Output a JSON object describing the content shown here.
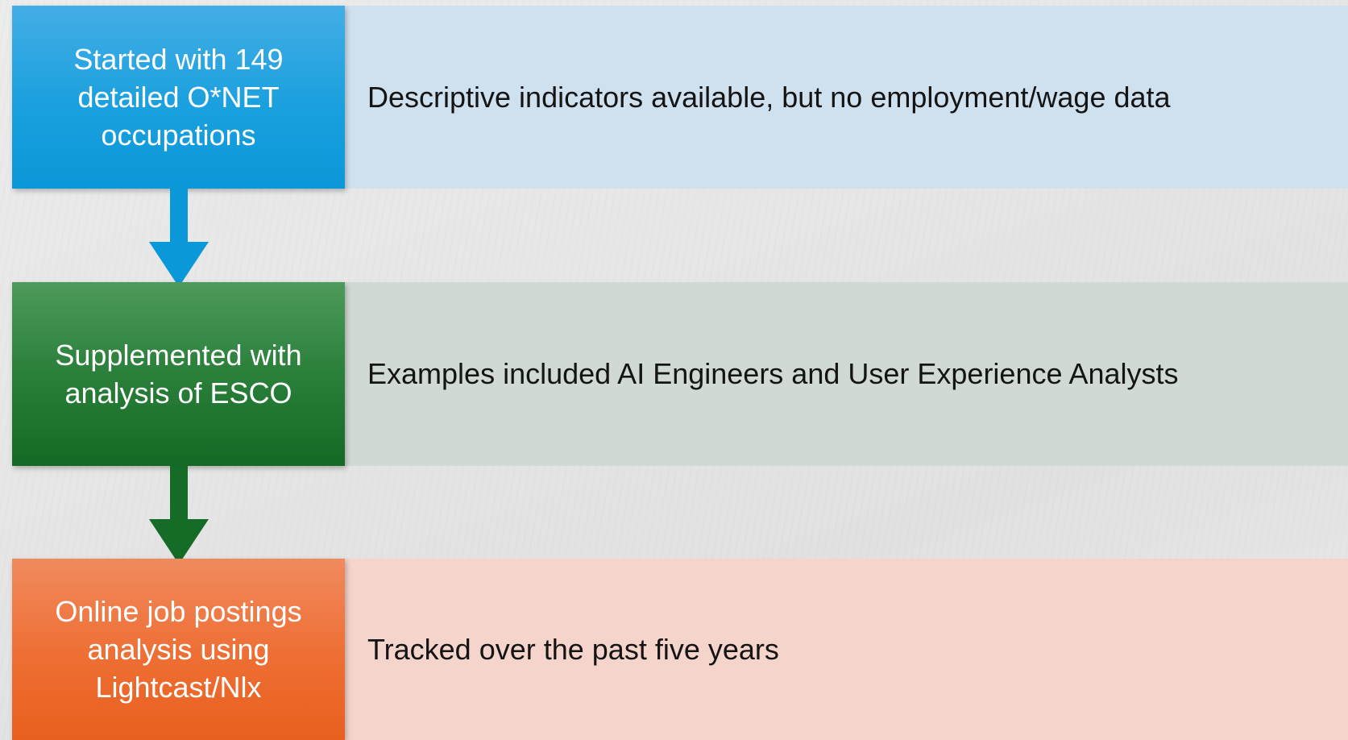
{
  "steps": [
    {
      "box_text": "Started with 149 detailed O*NET occupations",
      "detail": "Descriptive indicators available, but no employment/wage data",
      "box_color": "#1aa0de",
      "band_color": "#cfe0ee",
      "arrow_color": "#0b98d8"
    },
    {
      "box_text": "Supplemented with analysis of ESCO",
      "detail": "Examples included AI Engineers and User Experience Analysts",
      "box_color": "#1e7530",
      "band_color": "#d0d9d2",
      "arrow_color": "#156c26"
    },
    {
      "box_text": "Online job postings analysis using Lightcast/Nlx",
      "detail": "Tracked over the past five years",
      "box_color": "#ee6e33",
      "band_color": "#f5d4cc"
    }
  ]
}
